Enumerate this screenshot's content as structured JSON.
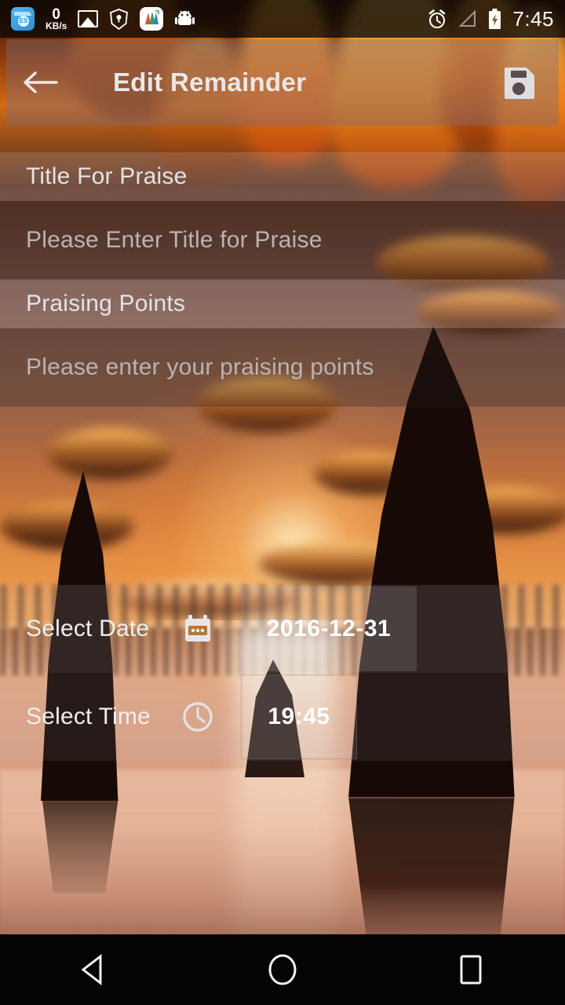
{
  "status_bar": {
    "left_icons": [
      {
        "name": "es-file-explorer-icon",
        "label": "ES"
      },
      {
        "name": "network-speed-indicator",
        "value": "0",
        "unit": "KB/s"
      },
      {
        "name": "gallery-icon",
        "label": ""
      },
      {
        "name": "brave-browser-icon",
        "label": ""
      },
      {
        "name": "mindmap-app-icon",
        "label": ""
      },
      {
        "name": "android-system-icon",
        "label": ""
      }
    ],
    "right_icons": [
      {
        "name": "alarm-icon"
      },
      {
        "name": "signal-icon"
      },
      {
        "name": "battery-charging-icon"
      }
    ],
    "clock": "7:45"
  },
  "app_bar": {
    "back_label": "←",
    "title": "Edit Remainder",
    "save_label": ""
  },
  "form": {
    "title_field": {
      "label": "Title For Praise",
      "placeholder": "Please Enter Title for Praise",
      "value": ""
    },
    "points_field": {
      "label": "Praising Points",
      "placeholder": "Please enter your praising points",
      "value": ""
    },
    "date_picker": {
      "label": "Select Date",
      "value": "2016-12-31"
    },
    "time_picker": {
      "label": "Select Time",
      "value": "19:45"
    }
  },
  "nav_bar": {
    "back": "back",
    "home": "home",
    "recents": "recents"
  },
  "colors": {
    "app_bar_overlay": "#7d6e7d",
    "label_text": "#e3e3e3",
    "placeholder_text": "#b9b4b2",
    "value_text": "#ffffff",
    "nav_background": "#040404"
  }
}
